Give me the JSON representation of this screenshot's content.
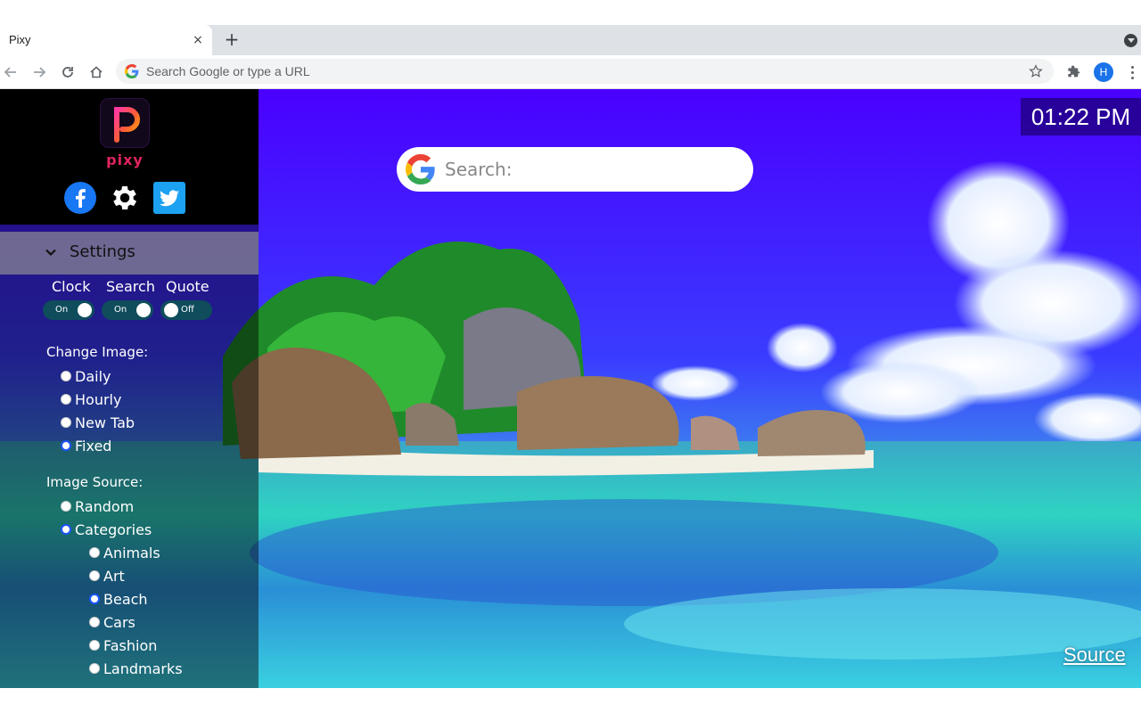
{
  "browser": {
    "tab_title": "Pixy",
    "close_glyph": "×",
    "newtab_glyph": "+",
    "omnibox_placeholder": "Search Google or type a URL",
    "profile_initial": "H"
  },
  "sidebar": {
    "logo_text": "pixy",
    "social_icons": [
      "facebook-icon",
      "gear-icon",
      "twitter-icon"
    ],
    "settings_label": "Settings",
    "toggles": [
      {
        "label": "Clock",
        "state": "On"
      },
      {
        "label": "Search",
        "state": "On"
      },
      {
        "label": "Quote",
        "state": "Off"
      }
    ],
    "change_image": {
      "label": "Change Image:",
      "options": [
        "Daily",
        "Hourly",
        "New Tab",
        "Fixed"
      ],
      "selected": "Fixed"
    },
    "image_source": {
      "label": "Image Source:",
      "options": [
        "Random",
        "Categories"
      ],
      "selected": "Categories",
      "categories": [
        "Animals",
        "Art",
        "Beach",
        "Cars",
        "Fashion",
        "Landmarks"
      ],
      "selected_category": "Beach"
    }
  },
  "clock": {
    "time": "01:22 PM"
  },
  "search": {
    "placeholder": "Search:"
  },
  "source_link": "Source",
  "colors": {
    "sky": "#4a00ff",
    "sidebar_black": "#000000",
    "toggle_bg": "#0f4c5c",
    "radio_checked": "#1a56ff",
    "logo_pink": "#e0245e"
  }
}
